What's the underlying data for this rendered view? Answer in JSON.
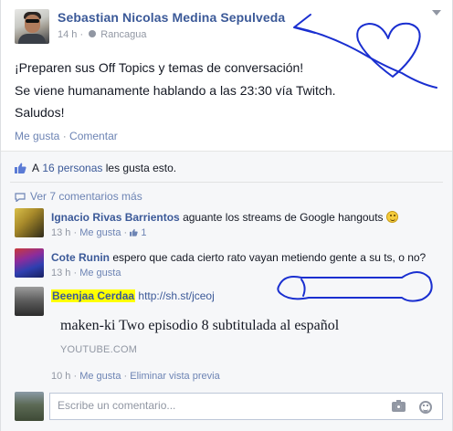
{
  "post": {
    "author": "Sebastian Nicolas Medina Sepulveda",
    "time": "14 h",
    "location": "Rancagua",
    "separator": "·",
    "lines": [
      "¡Preparen sus Off Topics y temas de conversación!",
      "Se viene humanamente hablando a las 23:30 vía Twitch.",
      "Saludos!"
    ],
    "like_label": "Me gusta",
    "comment_label": "Comentar"
  },
  "likes": {
    "prefix": "A",
    "count_text": "16 personas",
    "suffix": "les gusta esto."
  },
  "more_comments": "Ver 7 comentarios más",
  "comments": [
    {
      "name": "Ignacio Rivas Barrientos",
      "text": "aguante los streams de Google hangouts",
      "emoji": "smiley-emoji",
      "time": "13 h",
      "like_label": "Me gusta",
      "like_count": "1"
    },
    {
      "name": "Cote Runin",
      "text": "espero que cada cierto rato vayan metiendo gente a su ts, o no?",
      "time": "13 h",
      "like_label": "Me gusta"
    },
    {
      "name": "Beenjaa Cerdaa",
      "link": "http://sh.st/jceoj",
      "preview_title": "maken-ki Two episodio 8 subtitulada al español",
      "preview_source": "YOUTUBE.COM",
      "time": "10 h",
      "like_label": "Me gusta",
      "remove_preview_label": "Eliminar vista previa"
    }
  ],
  "composer": {
    "placeholder": "Escribe un comentario..."
  },
  "icons": {
    "privacy": "globe-icon",
    "likes": "thumbs-up-icon",
    "comments": "comment-bubble-icon",
    "camera": "camera-icon",
    "emoticon": "emoticon-icon",
    "menu": "chevron-down-icon"
  },
  "colors": {
    "link": "#3b5998",
    "muted": "#9197a3",
    "highlight": "#ffff00",
    "scribble": "#1a2fd0",
    "ufi_background": "#f6f7f9"
  }
}
